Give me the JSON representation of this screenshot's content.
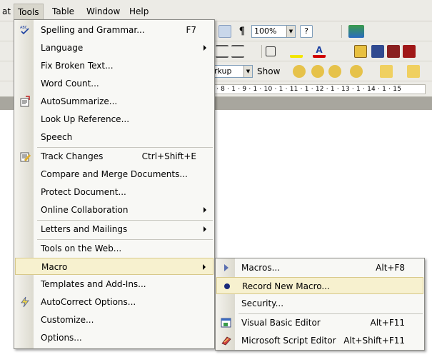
{
  "menubar": {
    "items": [
      {
        "label": "at"
      },
      {
        "label": "Tools",
        "open": true
      },
      {
        "label": "Table"
      },
      {
        "label": "Window"
      },
      {
        "label": "Help"
      }
    ]
  },
  "toolbar": {
    "zoom_value": "100%",
    "markup_value": "rkup",
    "show_label": "Show",
    "ruler_text": "· 8 · 1 · 9 · 1 · 10 · 1 · 11 · 1 · 12 · 1 · 13 · 1 · 14 · 1 · 15"
  },
  "tools_menu": {
    "items": [
      {
        "label": "Spelling and Grammar...",
        "shortcut": "F7",
        "icon": "spelling-check-icon"
      },
      {
        "label": "Language",
        "submenu": true
      },
      {
        "label": "Fix Broken Text..."
      },
      {
        "label": "Word Count..."
      },
      {
        "label": "AutoSummarize...",
        "icon": "autosummarize-icon"
      },
      {
        "label": "Look Up Reference..."
      },
      {
        "label": "Speech"
      },
      {
        "label": "Track Changes",
        "shortcut": "Ctrl+Shift+E",
        "icon": "track-changes-icon"
      },
      {
        "label": "Compare and Merge Documents..."
      },
      {
        "label": "Protect Document..."
      },
      {
        "label": "Online Collaboration",
        "submenu": true
      },
      {
        "label": "Letters and Mailings",
        "submenu": true
      },
      {
        "label": "Tools on the Web..."
      },
      {
        "label": "Macro",
        "submenu": true,
        "highlighted": true
      },
      {
        "label": "Templates and Add-Ins..."
      },
      {
        "label": "AutoCorrect Options...",
        "icon": "autocorrect-lightning-icon"
      },
      {
        "label": "Customize..."
      },
      {
        "label": "Options..."
      }
    ]
  },
  "macro_menu": {
    "items": [
      {
        "label": "Macros...",
        "shortcut": "Alt+F8",
        "icon": "play-triangle-icon"
      },
      {
        "label": "Record New Macro...",
        "icon": "record-dot-icon",
        "highlighted": true
      },
      {
        "label": "Security..."
      },
      {
        "label": "Visual Basic Editor",
        "shortcut": "Alt+F11",
        "icon": "visual-basic-editor-icon"
      },
      {
        "label": "Microsoft Script Editor",
        "shortcut": "Alt+Shift+F11",
        "icon": "script-editor-icon"
      }
    ]
  },
  "colors": {
    "highlight": "#f7f1cf",
    "highlight_border": "#d8c98a",
    "menu_bg": "#f8f8f5",
    "chrome": "#ecebe6"
  }
}
